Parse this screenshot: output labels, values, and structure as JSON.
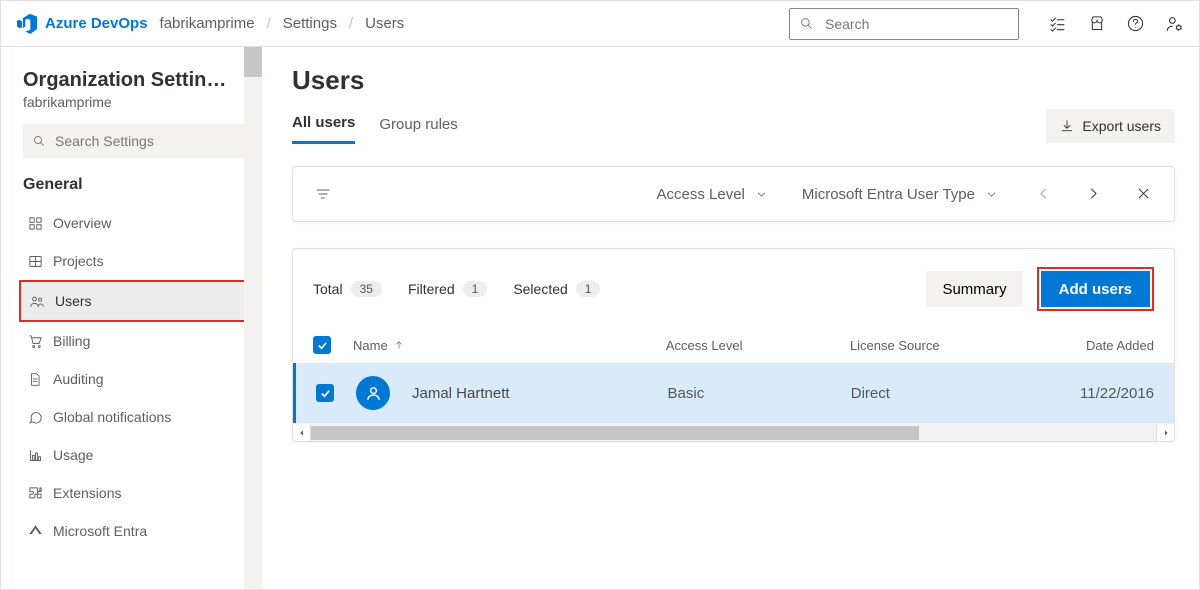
{
  "header": {
    "product": "Azure DevOps",
    "org": "fabrikamprime",
    "crumbs": [
      "Settings",
      "Users"
    ],
    "search_placeholder": "Search"
  },
  "sidebar": {
    "title": "Organization Settin…",
    "subtitle": "fabrikamprime",
    "search_placeholder": "Search Settings",
    "section": "General",
    "items": [
      {
        "label": "Overview"
      },
      {
        "label": "Projects"
      },
      {
        "label": "Users"
      },
      {
        "label": "Billing"
      },
      {
        "label": "Auditing"
      },
      {
        "label": "Global notifications"
      },
      {
        "label": "Usage"
      },
      {
        "label": "Extensions"
      },
      {
        "label": "Microsoft Entra"
      }
    ]
  },
  "main": {
    "title": "Users",
    "tabs": [
      "All users",
      "Group rules"
    ],
    "export_label": "Export users",
    "filters": {
      "access_level": "Access Level",
      "entra_type": "Microsoft Entra User Type"
    },
    "stats": {
      "total_label": "Total",
      "total": "35",
      "filtered_label": "Filtered",
      "filtered": "1",
      "selected_label": "Selected",
      "selected": "1"
    },
    "summary_label": "Summary",
    "add_label": "Add users",
    "columns": {
      "name": "Name",
      "access": "Access Level",
      "source": "License Source",
      "date": "Date Added"
    },
    "row": {
      "name": "Jamal Hartnett",
      "access": "Basic",
      "source": "Direct",
      "date": "11/22/2016"
    }
  }
}
